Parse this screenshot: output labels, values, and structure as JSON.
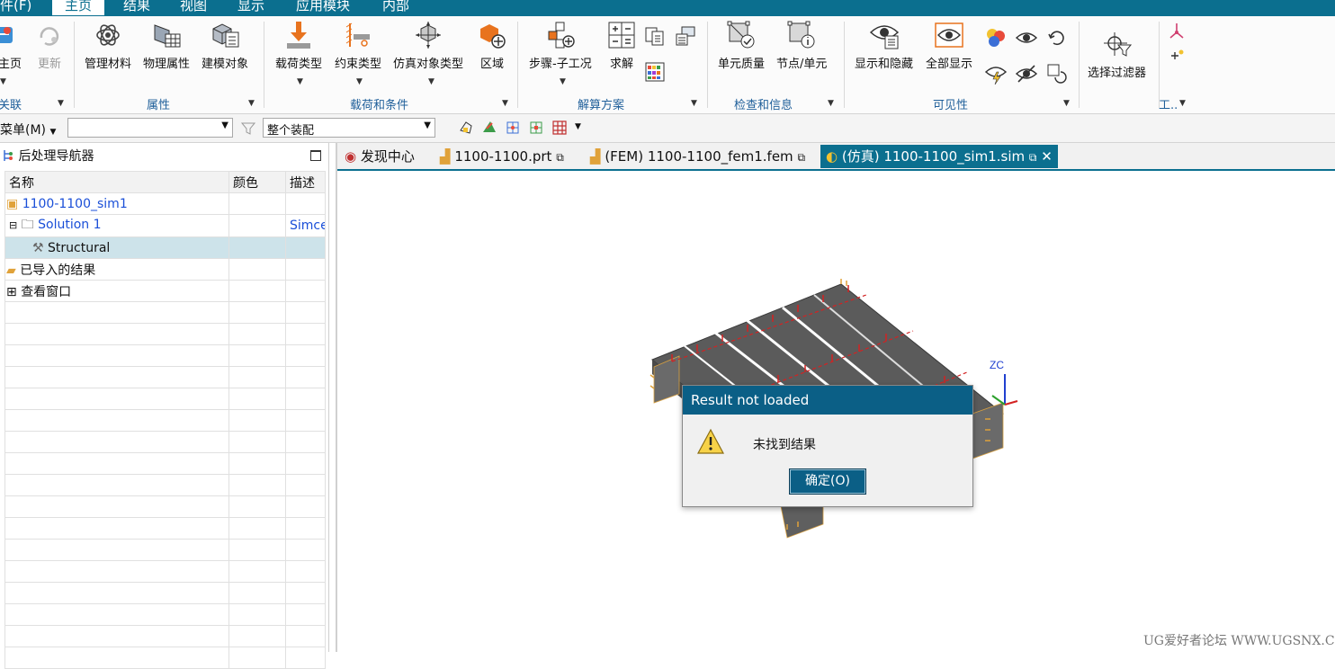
{
  "menu": {
    "items": [
      "件(F)",
      "主页",
      "结果",
      "视图",
      "显示",
      "应用模块",
      "内部"
    ]
  },
  "ribbon": {
    "buttons": {
      "home": "主页",
      "update": "更新",
      "manage_material": "管理材料",
      "physical_property": "物理属性",
      "modeling_object": "建模对象",
      "load_type": "载荷类型",
      "constraint_type": "约束类型",
      "sim_object_type": "仿真对象类型",
      "region": "区域",
      "step_subcase": "步骤-子工况",
      "solve": "求解",
      "element_quality": "单元质量",
      "node_element": "节点/单元",
      "show_hide": "显示和隐藏",
      "show_all": "全部显示",
      "select_filter": "选择过滤器"
    },
    "groups": {
      "associate": "关联",
      "properties": "属性",
      "loads_conditions": "载荷和条件",
      "solution": "解算方案",
      "check_info": "检查和信息",
      "visibility": "可见性",
      "tools": "工.."
    }
  },
  "toolbar": {
    "menu_label": "菜单(M)",
    "filter_value": "",
    "scope_value": "整个装配"
  },
  "navigator": {
    "title": "后处理导航器",
    "columns": [
      "名称",
      "颜色",
      "描述"
    ],
    "rows": [
      {
        "name": "1100-1100_sim1",
        "color": "",
        "desc": ""
      },
      {
        "name": "Solution 1",
        "color": "",
        "desc": "Simce"
      },
      {
        "name": "Structural",
        "color": "",
        "desc": ""
      },
      {
        "name": "已导入的结果",
        "color": "",
        "desc": ""
      },
      {
        "name": "查看窗口",
        "color": "",
        "desc": ""
      }
    ]
  },
  "tabs": [
    {
      "label": "发现中心"
    },
    {
      "label": "1100-1100.prt"
    },
    {
      "label": "(FEM) 1100-1100_fem1.fem"
    },
    {
      "label": "(仿真) 1100-1100_sim1.sim"
    }
  ],
  "viewport": {
    "axis_label": "ZC"
  },
  "dialog": {
    "title": "Result not loaded",
    "message": "未找到结果",
    "ok_label": "确定(O)"
  },
  "watermark": "UG爱好者论坛 WWW.UGSNX.COM",
  "colors": {
    "accent": "#0b6f8f",
    "dialog_title": "#0b5f86",
    "selection": "#cde3ea",
    "link_blue": "#1a4fd8",
    "model_gray": "#5b5b5b",
    "load_red": "#d32222",
    "constraint_orange": "#e0a23a"
  }
}
